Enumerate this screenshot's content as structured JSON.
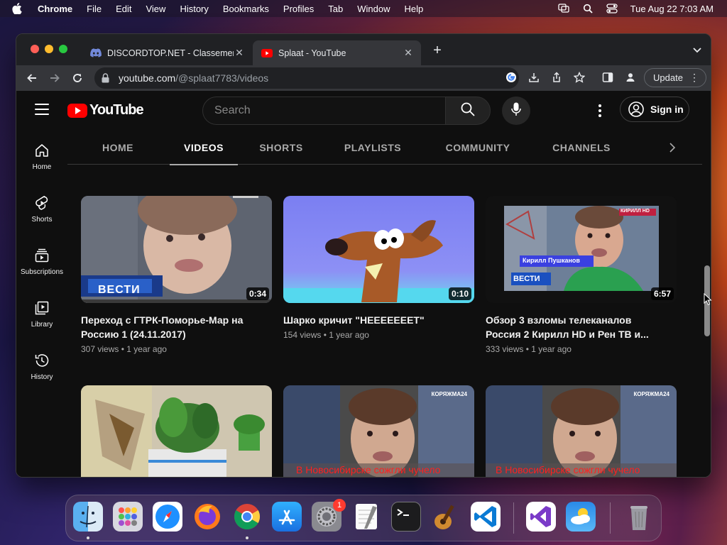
{
  "menubar": {
    "app": "Chrome",
    "items": [
      "File",
      "Edit",
      "View",
      "History",
      "Bookmarks",
      "Profiles",
      "Tab",
      "Window",
      "Help"
    ],
    "clock": "Tue Aug 22  7:03 AM"
  },
  "browser": {
    "tabs": [
      {
        "title": "DISCORDTOP.NET - Classement",
        "icon": "discord-icon"
      },
      {
        "title": "Splaat - YouTube",
        "icon": "youtube-icon"
      }
    ],
    "url_host": "youtube.com",
    "url_path": "/@splaat7783/videos",
    "update_label": "Update"
  },
  "youtube": {
    "logo_text": "YouTube",
    "search_placeholder": "Search",
    "signin_label": "Sign in",
    "sidebar": [
      {
        "label": "Home",
        "icon": "home-icon"
      },
      {
        "label": "Shorts",
        "icon": "shorts-icon"
      },
      {
        "label": "Subscriptions",
        "icon": "subscriptions-icon"
      },
      {
        "label": "Library",
        "icon": "library-icon"
      },
      {
        "label": "History",
        "icon": "history-icon"
      }
    ],
    "channel_tabs": [
      "HOME",
      "VIDEOS",
      "SHORTS",
      "PLAYLISTS",
      "COMMUNITY",
      "CHANNELS"
    ],
    "active_tab": "VIDEOS",
    "videos": [
      {
        "title_line1": "Переход с ГТРК-Поморье-Мар на",
        "title_line2": "Россию 1 (24.11.2017)",
        "meta": "307 views • 1 year ago",
        "duration": "0:34",
        "thumb_text": "ВЕСТИ"
      },
      {
        "title_line1": "Шарко кричит \"НЕЕЕЕЕЕЕТ\"",
        "title_line2": "",
        "meta": "154 views • 1 year ago",
        "duration": "0:10"
      },
      {
        "title_line1": "Обзор 3 взломы телеканалов",
        "title_line2": "Россия 2 Кирилл HD и Рен ТВ и...",
        "meta": "333 views • 1 year ago",
        "duration": "6:57",
        "thumb_text": "ВЕСТИ",
        "thumb_caption": "Кирилл Пушканов",
        "thumb_badge": "КИРИЛЛ HD"
      },
      {
        "title_line1": "",
        "title_line2": "",
        "meta": "",
        "duration": ""
      },
      {
        "title_line1": "",
        "title_line2": "",
        "meta": "",
        "duration": "",
        "thumb_caption": "В Новосибирске сожгли чучело",
        "thumb_badge": "КОРЯЖМА24"
      },
      {
        "title_line1": "",
        "title_line2": "",
        "meta": "",
        "duration": "",
        "thumb_caption": "В Новосибирске сожгли чучело",
        "thumb_badge": "КОРЯЖМА24"
      }
    ]
  },
  "dock": {
    "apps": [
      "finder-icon",
      "launchpad-icon",
      "safari-icon",
      "firefox-icon",
      "chrome-icon",
      "app-store-icon",
      "system-settings-icon",
      "textedit-icon",
      "terminal-icon",
      "garageband-icon",
      "vscode-icon",
      "visual-studio-icon",
      "weather-icon",
      "trash-icon"
    ],
    "settings_badge": "1"
  },
  "colors": {
    "yt_red": "#ff0000",
    "bg": "#0f0f0f",
    "chrome_dark": "#202124"
  }
}
